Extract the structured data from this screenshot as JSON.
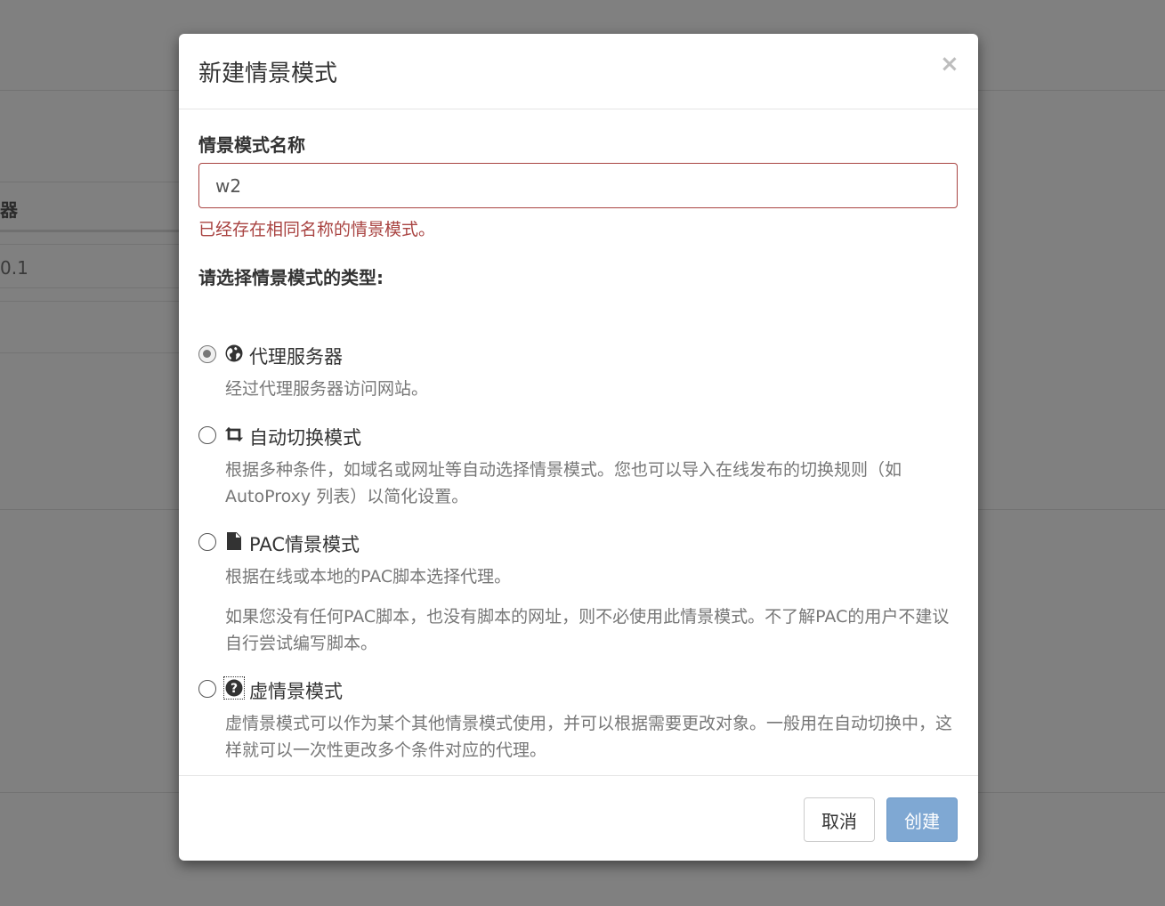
{
  "background": {
    "column_header": "器",
    "cell_value": "0.1"
  },
  "modal": {
    "title": "新建情景模式",
    "close_symbol": "×",
    "name_label": "情景模式名称",
    "name_value": "w2",
    "error_message": "已经存在相同名称的情景模式。",
    "type_label": "请选择情景模式的类型:",
    "options": [
      {
        "icon": "globe-icon",
        "title": "代理服务器",
        "selected": true,
        "descriptions": [
          "经过代理服务器访问网站。"
        ]
      },
      {
        "icon": "retweet-icon",
        "title": "自动切换模式",
        "selected": false,
        "descriptions": [
          "根据多种条件，如域名或网址等自动选择情景模式。您也可以导入在线发布的切换规则（如 AutoProxy 列表）以简化设置。"
        ]
      },
      {
        "icon": "file-icon",
        "title": "PAC情景模式",
        "selected": false,
        "descriptions": [
          "根据在线或本地的PAC脚本选择代理。",
          "如果您没有任何PAC脚本，也没有脚本的网址，则不必使用此情景模式。不了解PAC的用户不建议自行尝试编写脚本。"
        ]
      },
      {
        "icon": "question-circle-icon",
        "title": "虚情景模式",
        "selected": false,
        "descriptions": [
          "虚情景模式可以作为某个其他情景模式使用，并可以根据需要更改对象。一般用在自动切换中，这样就可以一次性更改多个条件对应的代理。"
        ]
      }
    ],
    "cancel_label": "取消",
    "create_label": "创建"
  },
  "colors": {
    "error": "#a94442",
    "primary_disabled": "#7fa8d3",
    "overlay": "#808080"
  }
}
